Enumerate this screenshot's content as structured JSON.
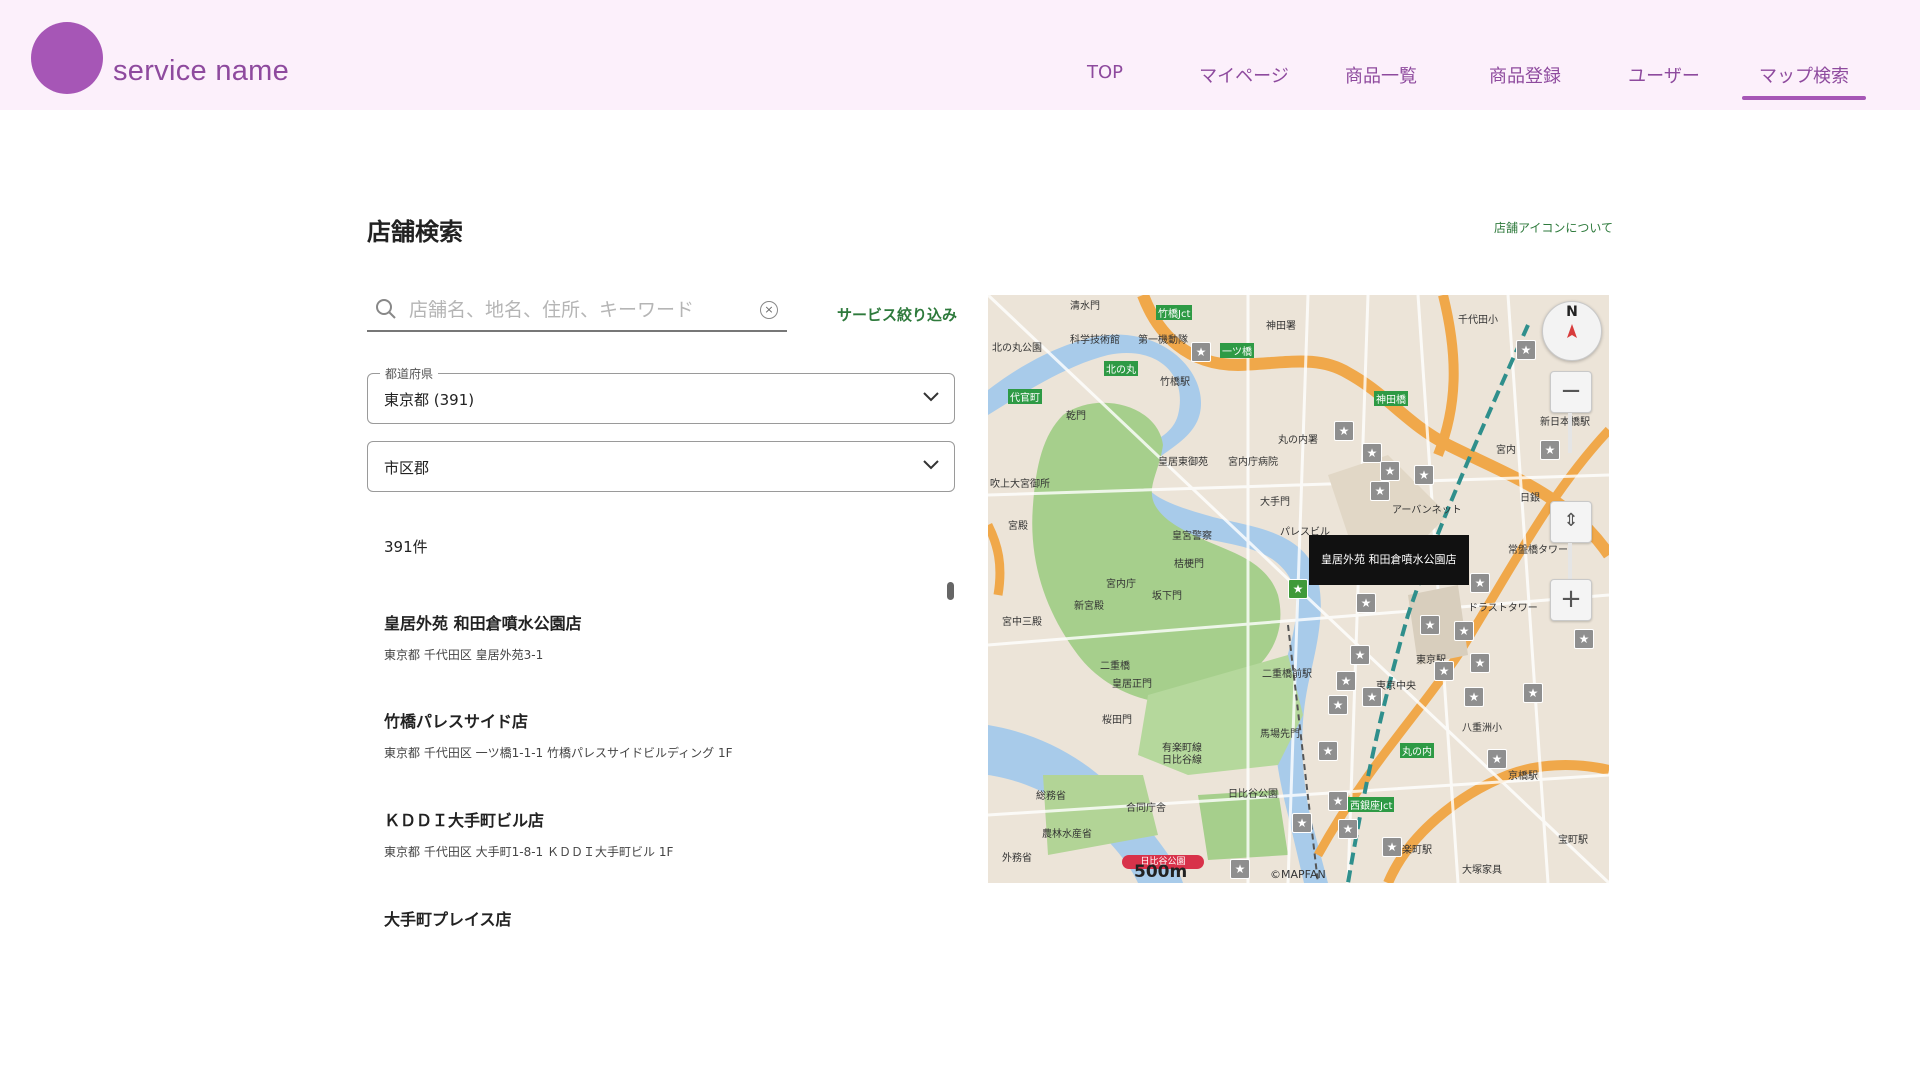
{
  "header": {
    "service_name": "service name",
    "nav": [
      {
        "label": "TOP"
      },
      {
        "label": "マイページ"
      },
      {
        "label": "商品一覧"
      },
      {
        "label": "商品登録"
      },
      {
        "label": "ユーザー"
      },
      {
        "label": "マップ検索",
        "active": true
      }
    ]
  },
  "page": {
    "title": "店舗検索",
    "icon_help_link": "店舗アイコンについて"
  },
  "search": {
    "placeholder": "店舗名、地名、住所、キーワード",
    "value": "",
    "clear_icon": "×",
    "service_filter_label": "サービス絞り込み"
  },
  "filters": {
    "prefecture": {
      "label": "都道府県",
      "value": "東京都 (391)"
    },
    "city": {
      "value": "市区郡"
    }
  },
  "results": {
    "count_text": "391件",
    "stores": [
      {
        "name": "皇居外苑 和田倉噴水公園店",
        "address": "東京都 千代田区 皇居外苑3-1"
      },
      {
        "name": "竹橋パレスサイド店",
        "address": "東京都 千代田区 一ツ橋1-1-1 竹橋パレスサイドビルディング 1F"
      },
      {
        "name": "ＫＤＤＩ大手町ビル店",
        "address": "東京都 千代田区 大手町1-8-1 ＫＤＤＩ大手町ビル 1F"
      },
      {
        "name": "大手町プレイス店",
        "address": ""
      }
    ]
  },
  "map": {
    "tooltip": "皇居外苑 和田倉噴水公園店",
    "compass_label": "N",
    "zoom_out": "−",
    "zoom_in": "+",
    "tilt_icon": "⇕",
    "scale_text": "500m",
    "scale_badge": "日比谷公園",
    "copyright": "©MAPFAN",
    "star_glyph": "★",
    "labels": [
      "清水門",
      "竹橋Jct",
      "神田署",
      "千代田小",
      "北の丸公園",
      "科学技術館",
      "第一機動隊",
      "一ツ橋",
      "竹橋駅",
      "北の丸",
      "代官町",
      "乾門",
      "丸の内署",
      "神田橋",
      "皇居東御苑",
      "宮内庁病院",
      "吹上大宮御所",
      "大手門",
      "アーバンネット",
      "皇宮警察",
      "パレスビル",
      "宮殿",
      "宮内庁",
      "桔梗門",
      "坂下門",
      "新宮殿",
      "宮中三殿",
      "二重橋",
      "皇居正門",
      "桜田門",
      "有楽町線",
      "日比谷線",
      "馬場先門",
      "日比谷公園",
      "総務省",
      "合同庁舎",
      "農林水産省",
      "外務省",
      "二重橋前駅",
      "東京駅",
      "東京中央",
      "丸の内",
      "西銀座Jct",
      "有楽町駅",
      "ドラストタワー",
      "新日本橋駅",
      "日銀",
      "京橋駅",
      "宝町駅",
      "八重洲小",
      "大塚家具",
      "宮内",
      "常盤橋タワー"
    ]
  },
  "colors": {
    "header_bg": "#fcf0fb",
    "brand": "#a656b6",
    "nav_text": "#8e4a9e",
    "accent_green": "#2e7a3c",
    "map_water": "#a8cbea",
    "map_park": "#a6cf8c",
    "map_highway": "#f0a84a"
  }
}
